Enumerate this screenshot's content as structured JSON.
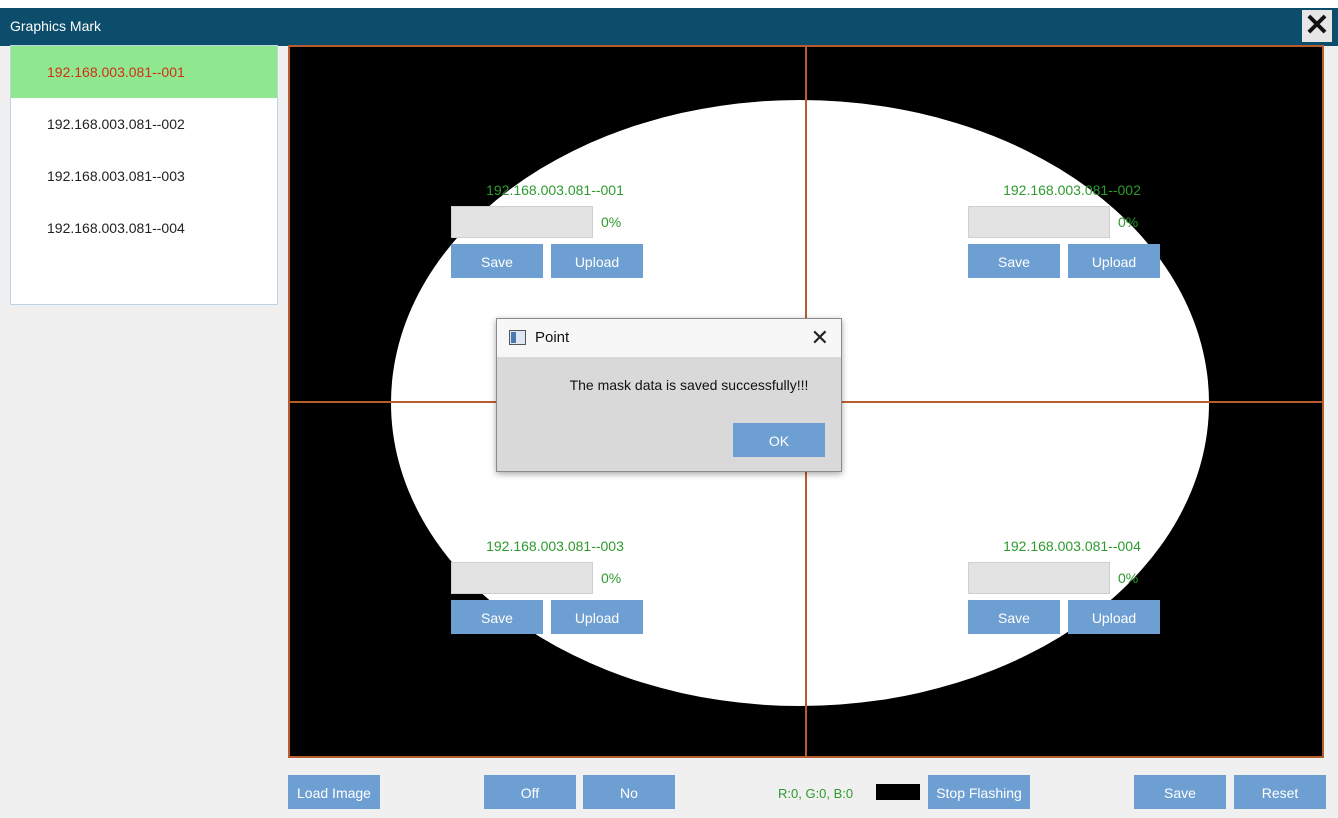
{
  "window": {
    "title": "Graphics Mark",
    "close_symbol": "✕"
  },
  "sidebar": {
    "items": [
      {
        "label": "192.168.003.081--001",
        "active": true
      },
      {
        "label": "192.168.003.081--002",
        "active": false
      },
      {
        "label": "192.168.003.081--003",
        "active": false
      },
      {
        "label": "192.168.003.081--004",
        "active": false
      }
    ]
  },
  "cameras": [
    {
      "label": "192.168.003.081--001",
      "progress": "0%",
      "progress_value": 0,
      "save": "Save",
      "upload": "Upload"
    },
    {
      "label": "192.168.003.081--002",
      "progress": "0%",
      "progress_value": 0,
      "save": "Save",
      "upload": "Upload"
    },
    {
      "label": "192.168.003.081--003",
      "progress": "0%",
      "progress_value": 0,
      "save": "Save",
      "upload": "Upload"
    },
    {
      "label": "192.168.003.081--004",
      "progress": "0%",
      "progress_value": 0,
      "save": "Save",
      "upload": "Upload"
    }
  ],
  "dialog": {
    "title": "Point",
    "close_symbol": "✕",
    "message": "The mask data is saved successfully!!!",
    "ok": "OK"
  },
  "toolbar": {
    "load_image": "Load Image",
    "off": "Off",
    "no": "No",
    "rgb_readout": "R:0, G:0, B:0",
    "swatch_color": "#000000",
    "stop_flashing": "Stop Flashing",
    "save": "Save",
    "reset": "Reset"
  },
  "colors": {
    "titlebar": "#0b4d6a",
    "active_item_bg": "#8fe88f",
    "active_item_text": "#d03018",
    "button": "#6e9fd2",
    "label_green": "#2e9a2e",
    "crosshair": "#b85c2e"
  }
}
